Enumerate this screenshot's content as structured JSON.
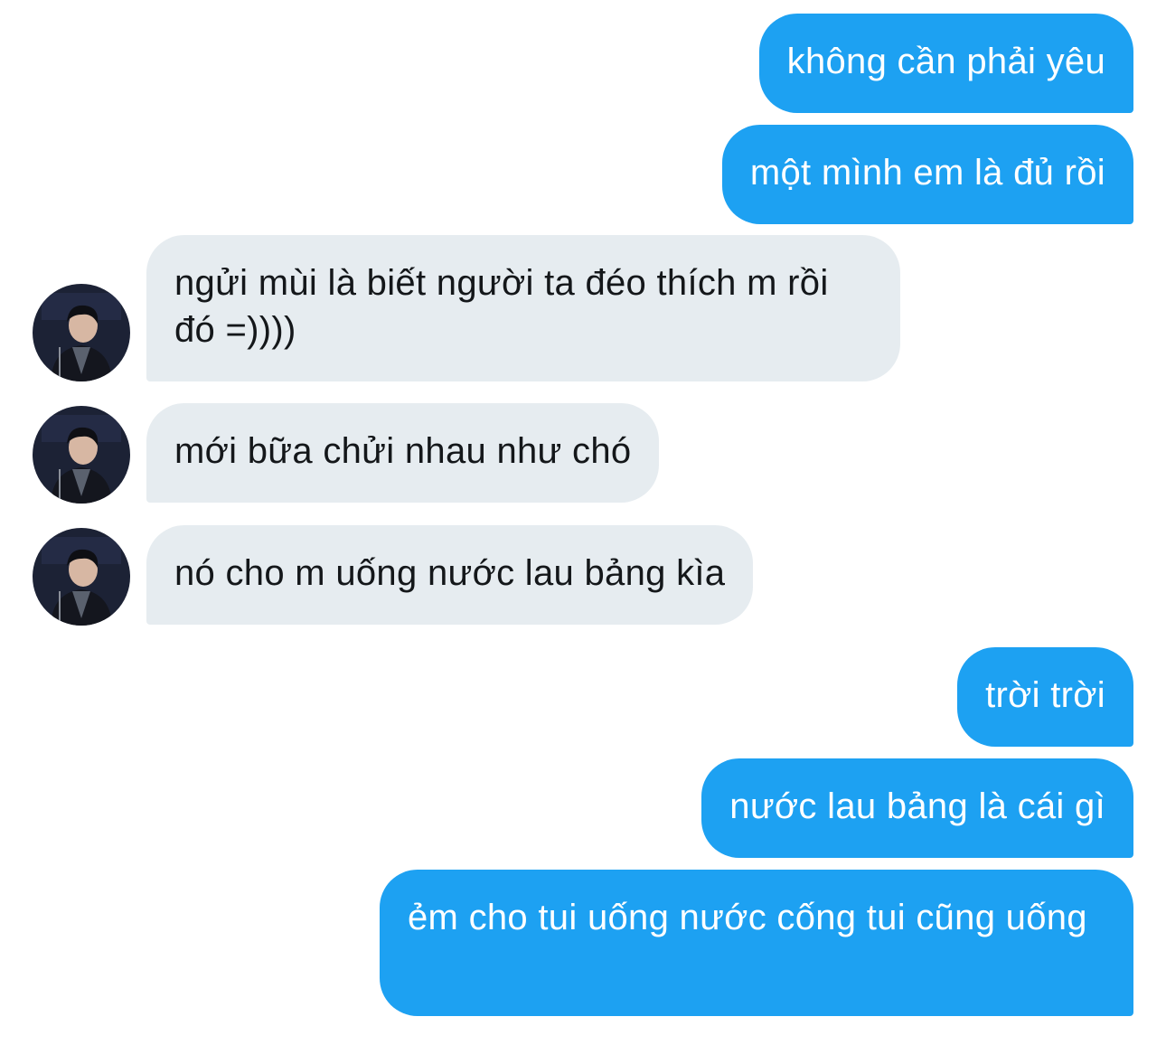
{
  "conversation": {
    "messages": [
      {
        "sender": "me",
        "text": "không cần phải yêu"
      },
      {
        "sender": "me",
        "text": "một mình em là đủ rồi"
      },
      {
        "sender": "other",
        "text": "ngửi mùi là biết người ta đéo thích m rồi đó =))))",
        "avatar": "profile-photo"
      },
      {
        "sender": "other",
        "text": "mới bữa chửi nhau như chó",
        "avatar": "profile-photo"
      },
      {
        "sender": "other",
        "text": "nó cho m uống nước lau bảng kìa",
        "avatar": "profile-photo"
      },
      {
        "sender": "me",
        "text": "trời trời"
      },
      {
        "sender": "me",
        "text": "nước lau bảng là cái gì"
      },
      {
        "sender": "me",
        "text": "ẻm cho tui uống nước cống tui cũng uống"
      }
    ]
  },
  "colors": {
    "sent_bubble": "#1da1f2",
    "received_bubble": "#e6ecf0",
    "sent_text": "#ffffff",
    "received_text": "#14171a"
  }
}
